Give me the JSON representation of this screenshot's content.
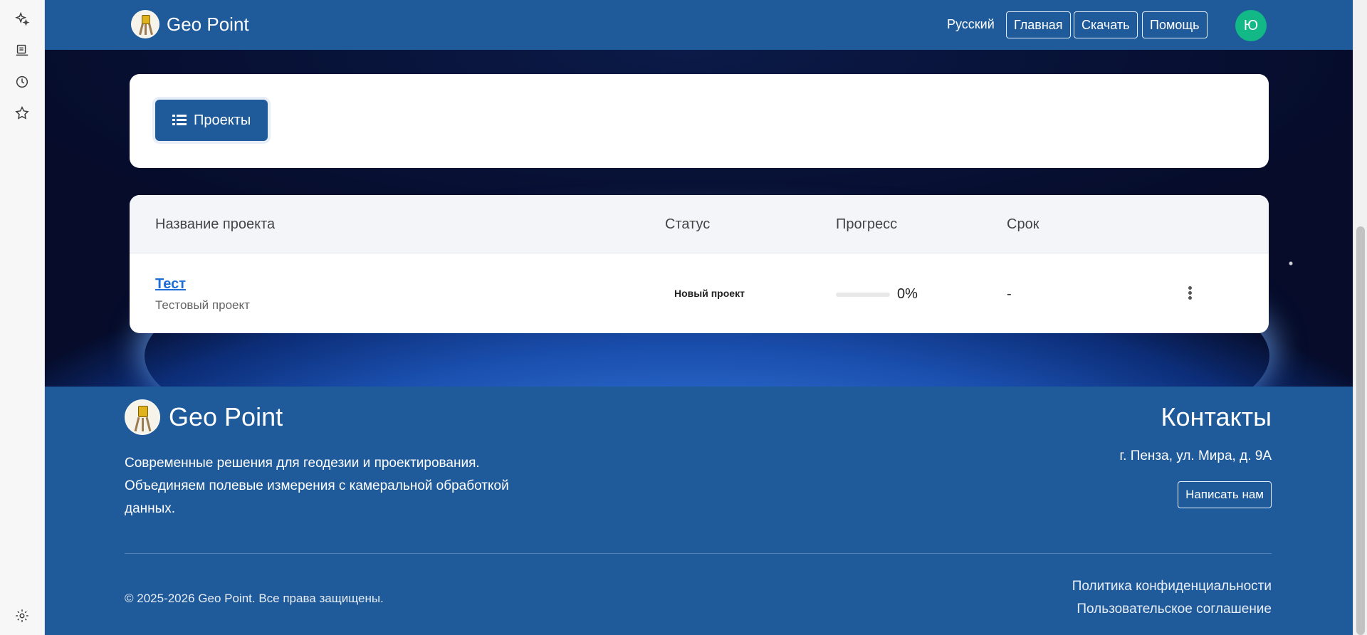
{
  "browser_rail": {
    "icons": [
      "sparkle-icon",
      "reading-list-icon",
      "history-icon",
      "favorites-icon",
      "settings-icon"
    ]
  },
  "navbar": {
    "brand": "Geo Point",
    "language": "Русский",
    "links": [
      "Главная",
      "Скачать",
      "Помощь"
    ],
    "avatar_initial": "Ю"
  },
  "toolbar": {
    "projects_label": "Проекты"
  },
  "table": {
    "headers": [
      "Название проекта",
      "Статус",
      "Прогресс",
      "Срок"
    ],
    "rows": [
      {
        "name": "Тест",
        "description": "Тестовый проект",
        "status": "Новый проект",
        "progress_value": 0,
        "progress_text": "0%",
        "deadline": "-"
      }
    ]
  },
  "footer": {
    "brand": "Geo Point",
    "description": "Современные решения для геодезии и проектирования. Объединяем полевые измерения с камеральной обработкой данных.",
    "contacts_title": "Контакты",
    "address": "г. Пенза, ул. Мира, д. 9А",
    "write_us": "Написать нам",
    "copyright": "© 2025-2026 Geo Point. Все права защищены.",
    "privacy": "Политика конфиденциальности",
    "agreement": "Пользовательское соглашение"
  },
  "colors": {
    "primary": "#1f5a9a",
    "avatar": "#12b886",
    "link": "#1c6ed6"
  }
}
